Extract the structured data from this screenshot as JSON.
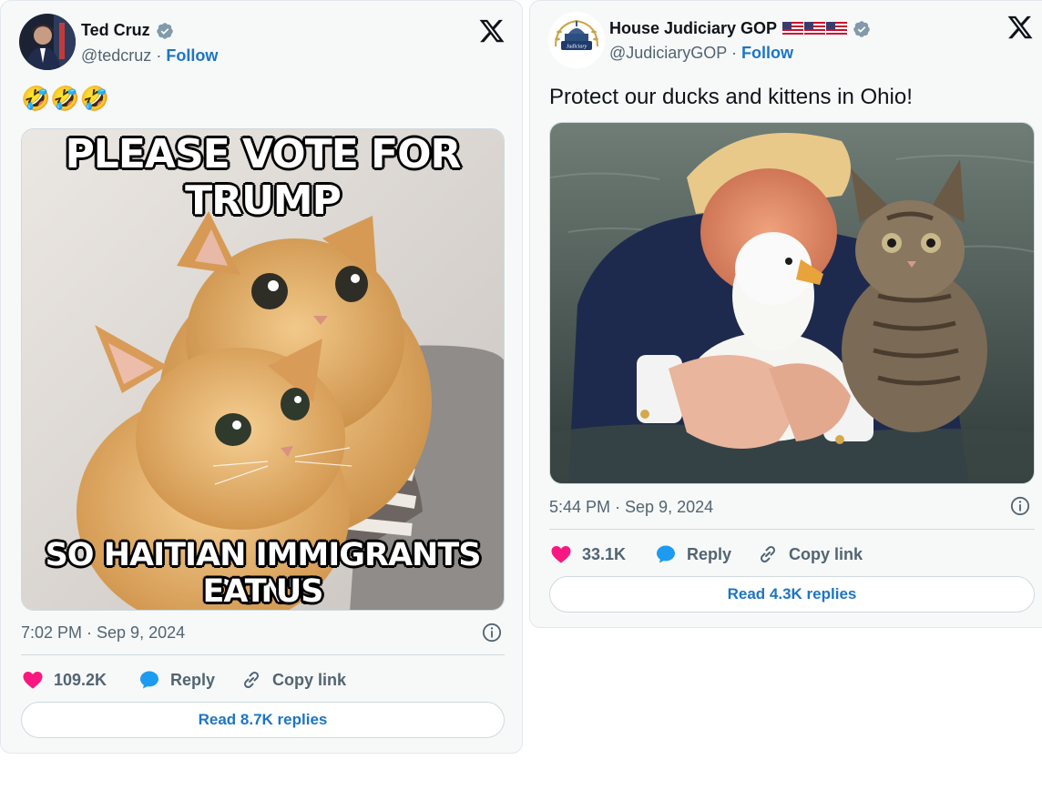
{
  "tweets": [
    {
      "author_name": "Ted Cruz",
      "handle": "@tedcruz",
      "separator": "·",
      "follow_label": "Follow",
      "text": "🤣🤣🤣",
      "meme_top": "PLEASE VOTE FOR TRUMP",
      "meme_bottom_1": "SO HAITIAN IMMIGRANTS DON'T",
      "meme_bottom_2": "EAT US",
      "timestamp": "7:02 PM · Sep 9, 2024",
      "likes": "109.2K",
      "reply_label": "Reply",
      "copy_link_label": "Copy link",
      "read_replies_label": "Read 8.7K replies"
    },
    {
      "author_name": "House Judiciary GOP",
      "handle": "@JudiciaryGOP",
      "separator": "·",
      "follow_label": "Follow",
      "text": "Protect our ducks and kittens in Ohio!",
      "timestamp": "5:44 PM · Sep 9, 2024",
      "likes": "33.1K",
      "reply_label": "Reply",
      "copy_link_label": "Copy link",
      "read_replies_label": "Read 4.3K replies"
    }
  ],
  "colors": {
    "link_blue": "#1d75c4",
    "like_pink": "#f91880",
    "reply_blue": "#1d9bf0",
    "verified_blue": "#829aab"
  },
  "icons": {
    "logo": "x-logo-icon",
    "verified": "verified-badge-icon",
    "like": "heart-icon",
    "reply": "speech-bubble-icon",
    "copy": "link-icon",
    "info": "info-icon",
    "flag": "us-flag-icon"
  }
}
